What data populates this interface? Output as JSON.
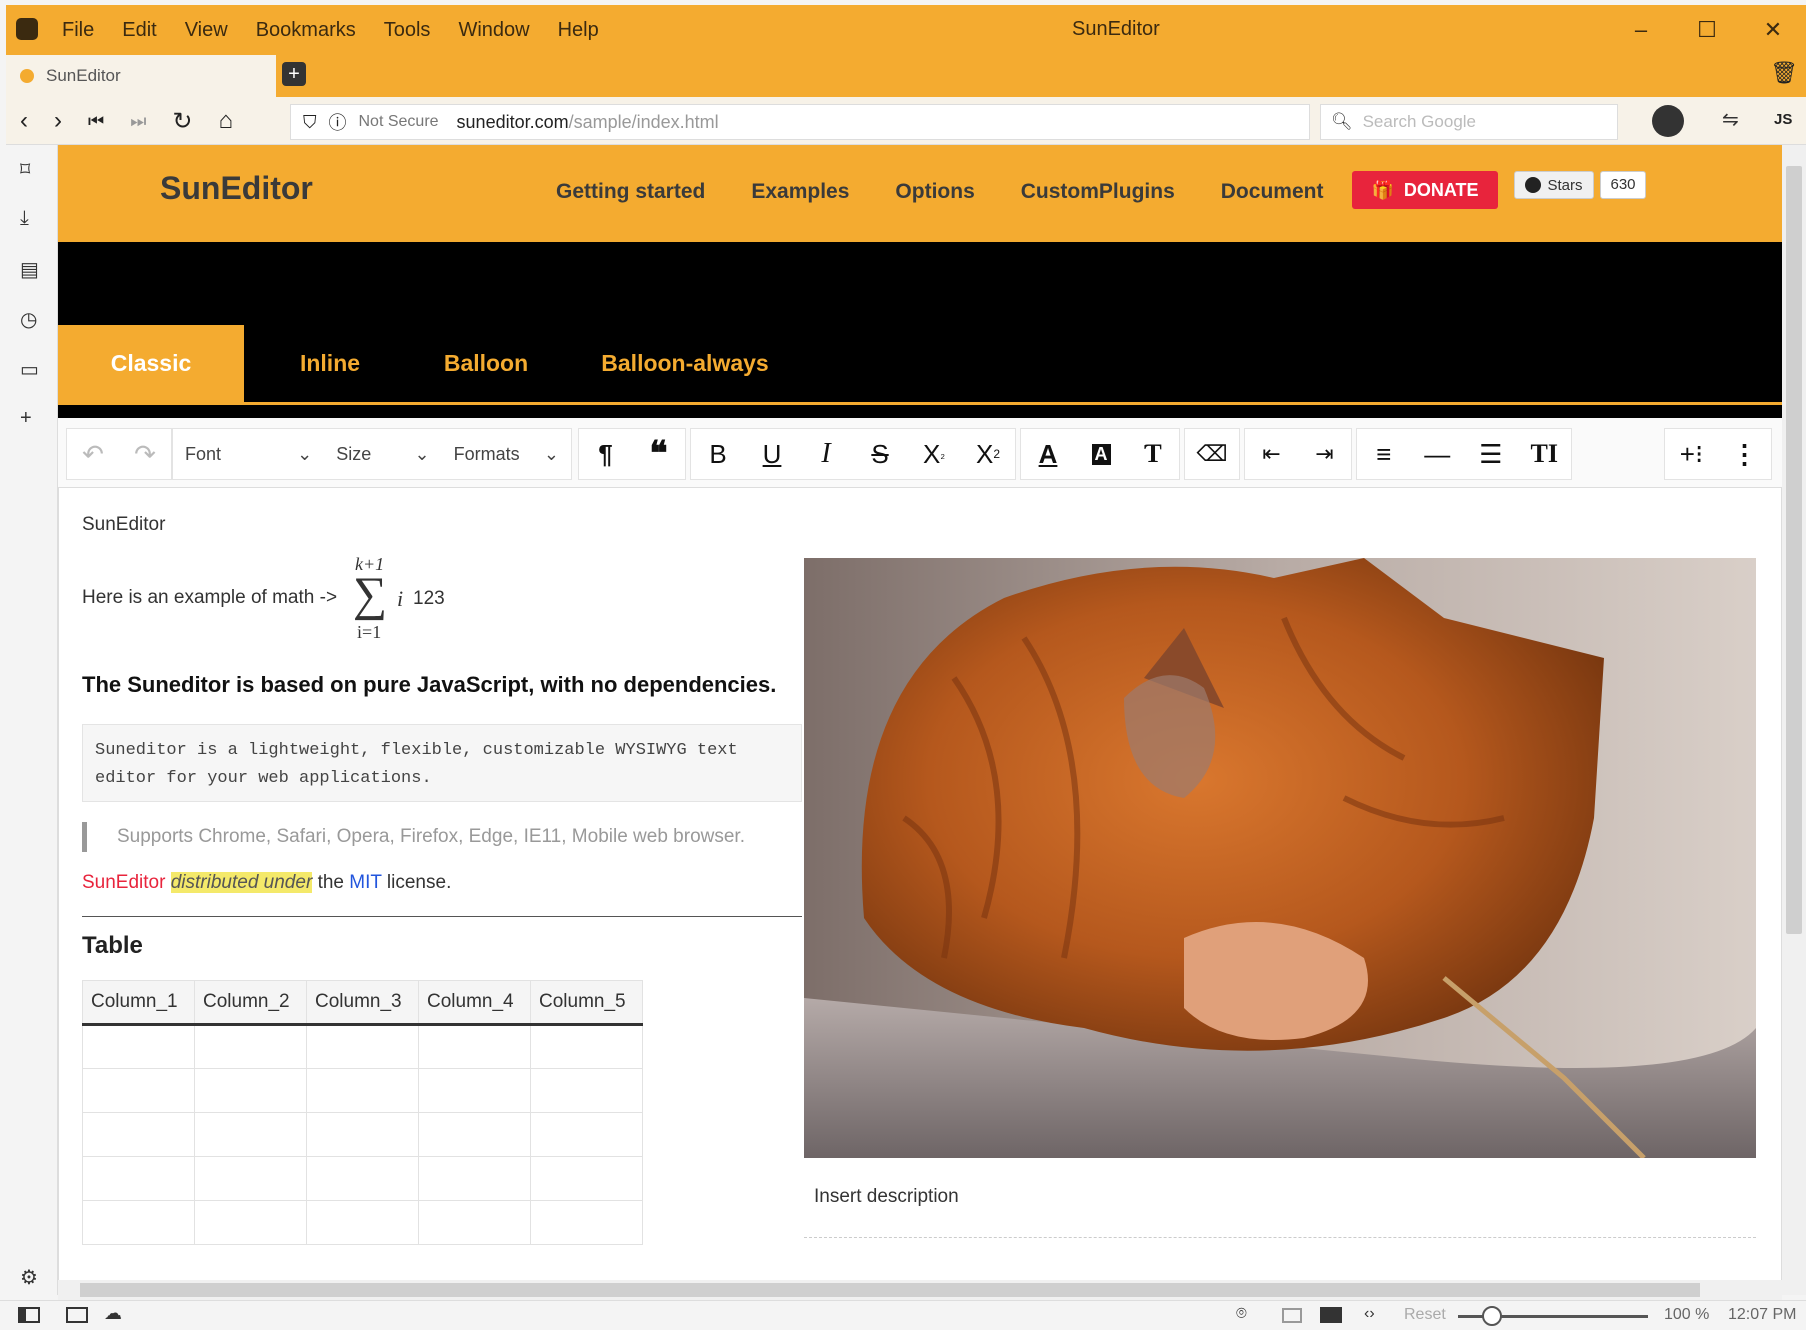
{
  "browser": {
    "menu": [
      "File",
      "Edit",
      "View",
      "Bookmarks",
      "Tools",
      "Window",
      "Help"
    ],
    "window_title": "SunEditor",
    "tab_title": "SunEditor",
    "url_security": "Not Secure",
    "url_domain": "suneditor.com",
    "url_path": "/sample/index.html",
    "search_placeholder": "Search Google",
    "js_label": "JS"
  },
  "site": {
    "logo": "SunEditor",
    "nav": [
      "Getting started",
      "Examples",
      "Options",
      "CustomPlugins",
      "Document"
    ],
    "donate_label": "DONATE",
    "stars_label": "Stars",
    "stars_count": "630"
  },
  "modes": [
    {
      "label": "Classic",
      "active": true
    },
    {
      "label": "Inline",
      "active": false
    },
    {
      "label": "Balloon",
      "active": false
    },
    {
      "label": "Balloon-always",
      "active": false
    }
  ],
  "toolbar": {
    "font_label": "Font",
    "size_label": "Size",
    "formats_label": "Formats"
  },
  "content": {
    "label": "SunEditor",
    "math_prefix": "Here is an example of math ->",
    "math_upper": "k+1",
    "math_lower": "i=1",
    "math_term": "i",
    "math_suffix": "123",
    "bold_text": "The Suneditor is based on pure JavaScript, with no dependencies.",
    "code_line1": "Suneditor is a lightweight, flexible, customizable WYSIWYG text",
    "code_line2": "editor for your web applications.",
    "quote": "Supports Chrome, Safari, Opera, Firefox, Edge, IE11, Mobile web browser.",
    "lic_red": "SunEditor",
    "lic_highlight": "distributed under",
    "lic_the": "the",
    "lic_mit": "MIT",
    "lic_end": "license.",
    "table_title": "Table",
    "table_headers": [
      "Column_1",
      "Column_2",
      "Column_3",
      "Column_4",
      "Column_5"
    ],
    "image_caption": "Insert description"
  },
  "status": {
    "reset_label": "Reset",
    "zoom": "100 %",
    "time": "12:07 PM",
    "zoom_level": 0.1
  },
  "colors": {
    "accent": "#f4ab30",
    "donate": "#e8243c",
    "license_red": "#e8243c",
    "mit_blue": "#2255dd",
    "highlight": "#f4e96a"
  }
}
